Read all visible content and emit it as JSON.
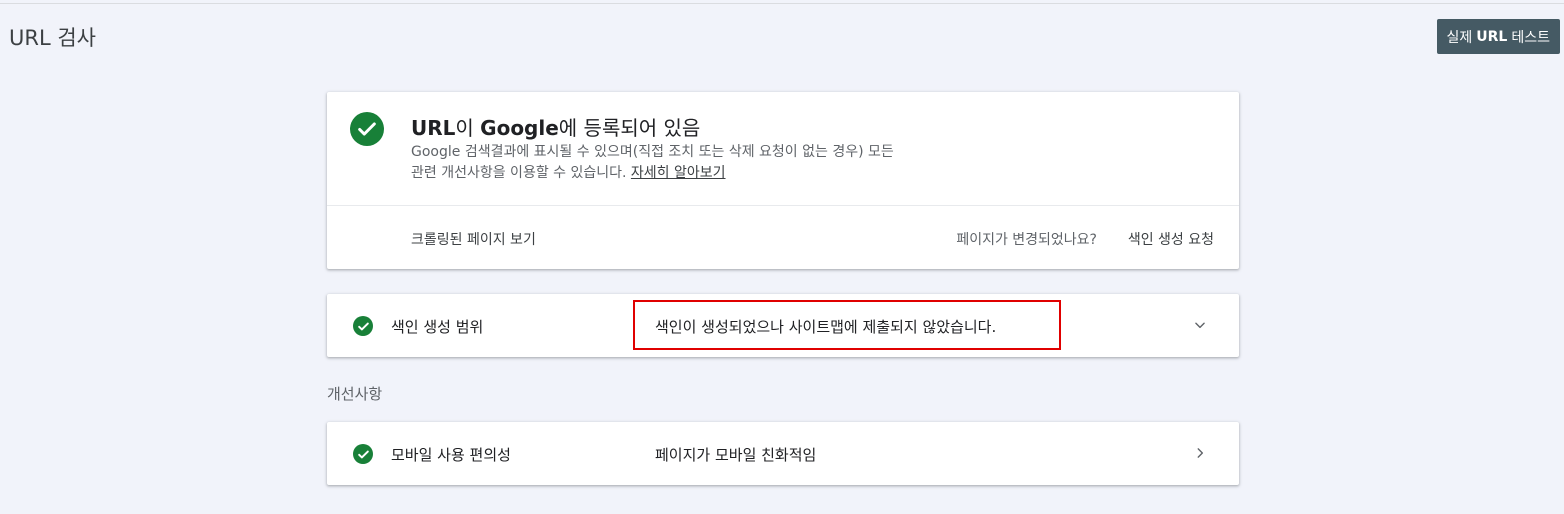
{
  "header": {
    "title": "URL 검사",
    "test_button": {
      "label_pre": "실제",
      "label_bold": "URL",
      "label_post": "테스트"
    }
  },
  "status_card": {
    "icon": "check-circle-icon",
    "headline_bold1": "URL",
    "headline_part1": "이 ",
    "headline_bold2": "Google",
    "headline_part2": "에 등록되어 있음",
    "description_line1": "Google 검색결과에 표시될 수 있으며(직접 조치 또는 삭제 요청이 없는 경우) 모든",
    "description_line2": "관련 개선사항을 이용할 수 있습니다.",
    "learn_more": "자세히 알아보기",
    "crawled_page_link": "크롤링된 페이지 보기",
    "changed_question": "페이지가 변경되었나요?",
    "request_indexing": "색인 생성 요청"
  },
  "coverage_row": {
    "icon": "check-circle-icon",
    "label": "색인 생성 범위",
    "value": "색인이 생성되었으나 사이트맵에 제출되지 않았습니다.",
    "chevron": "chevron-down-icon"
  },
  "enhancements": {
    "section_label": "개선사항",
    "mobile_row": {
      "icon": "check-circle-icon",
      "label": "모바일 사용 편의성",
      "value": "페이지가 모바일 친화적임",
      "chevron": "chevron-right-icon"
    }
  },
  "colors": {
    "background": "#f1f3fa",
    "success_green": "#188038",
    "button_bg": "#455a64",
    "highlight_red": "#e00000"
  }
}
